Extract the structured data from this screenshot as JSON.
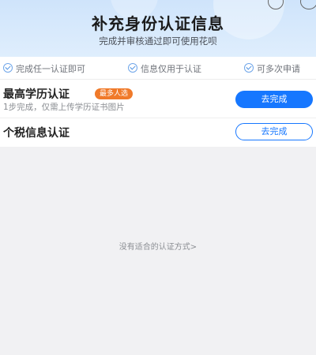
{
  "header": {
    "title": "补充身份认证信息",
    "subtitle": "完成并审核通过即可使用花呗"
  },
  "features": [
    {
      "text": "完成任一认证即可",
      "icon": "check-circle-icon"
    },
    {
      "text": "信息仅用于认证",
      "icon": "check-circle-icon"
    },
    {
      "text": "可多次申请",
      "icon": "check-circle-icon"
    }
  ],
  "options": [
    {
      "title": "最高学历认证",
      "badge": "最多人选",
      "desc": "1步完成，仅需上传学历证书图片",
      "button": "去完成"
    },
    {
      "title": "个税信息认证",
      "button": "去完成"
    }
  ],
  "empty_text": "没有适合的认证方式>",
  "colors": {
    "accent": "#1677ff",
    "badge": "#f07a2a",
    "header_bg": "#d6e8fb"
  }
}
